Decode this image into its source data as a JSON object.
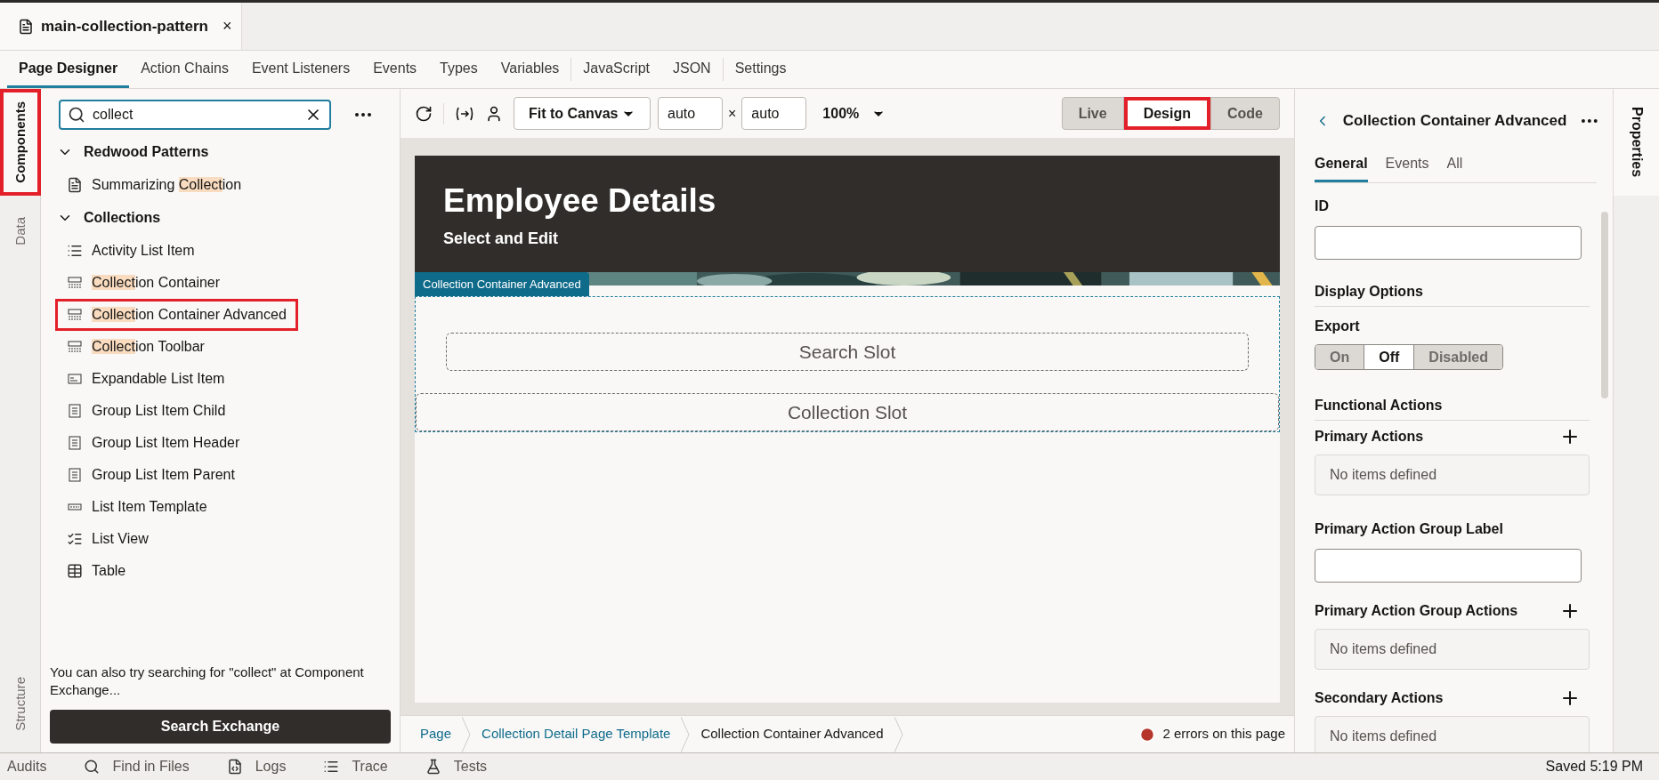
{
  "file_tab": {
    "title": "main-collection-pattern",
    "close": "×"
  },
  "nav_tabs": [
    {
      "label": "Page Designer",
      "selected": true
    },
    {
      "label": "Action Chains",
      "selected": false
    },
    {
      "label": "Event Listeners",
      "selected": false
    },
    {
      "label": "Events",
      "selected": false
    },
    {
      "label": "Types",
      "selected": false
    },
    {
      "label": "Variables",
      "selected": false
    },
    {
      "label": "JavaScript",
      "selected": false
    },
    {
      "label": "JSON",
      "selected": false
    },
    {
      "label": "Settings",
      "selected": false
    }
  ],
  "left_rail": [
    {
      "label": "Components",
      "selected": true,
      "annotated": true
    },
    {
      "label": "Data",
      "selected": false,
      "annotated": false
    },
    {
      "label": "Structure",
      "selected": false,
      "annotated": false
    }
  ],
  "components": {
    "search": {
      "value": "collect"
    },
    "groups": [
      {
        "title": "Redwood Patterns",
        "expanded": true,
        "items": [
          {
            "kind": "summary",
            "annotated": false,
            "segments": [
              {
                "text": "Summarizing ",
                "highlight": false
              },
              {
                "text": "Collect",
                "highlight": true
              },
              {
                "text": "ion",
                "highlight": false
              }
            ]
          }
        ]
      },
      {
        "title": "Collections",
        "expanded": true,
        "items": [
          {
            "kind": "activity",
            "annotated": false,
            "segments": [
              {
                "text": "Activity List Item",
                "highlight": false
              }
            ]
          },
          {
            "kind": "container",
            "annotated": false,
            "segments": [
              {
                "text": "Collect",
                "highlight": true
              },
              {
                "text": "ion Container",
                "highlight": false
              }
            ]
          },
          {
            "kind": "container",
            "annotated": true,
            "segments": [
              {
                "text": "Collect",
                "highlight": true
              },
              {
                "text": "ion Container Advanced",
                "highlight": false
              }
            ]
          },
          {
            "kind": "container",
            "annotated": false,
            "segments": [
              {
                "text": "Collect",
                "highlight": true
              },
              {
                "text": "ion Toolbar",
                "highlight": false
              }
            ]
          },
          {
            "kind": "expandable",
            "annotated": false,
            "segments": [
              {
                "text": "Expandable List Item",
                "highlight": false
              }
            ]
          },
          {
            "kind": "group",
            "annotated": false,
            "segments": [
              {
                "text": "Group List Item Child",
                "highlight": false
              }
            ]
          },
          {
            "kind": "group",
            "annotated": false,
            "segments": [
              {
                "text": "Group List Item Header",
                "highlight": false
              }
            ]
          },
          {
            "kind": "group",
            "annotated": false,
            "segments": [
              {
                "text": "Group List Item Parent",
                "highlight": false
              }
            ]
          },
          {
            "kind": "template",
            "annotated": false,
            "segments": [
              {
                "text": "List Item Template",
                "highlight": false
              }
            ]
          },
          {
            "kind": "listview",
            "annotated": false,
            "segments": [
              {
                "text": "List View",
                "highlight": false
              }
            ]
          },
          {
            "kind": "table",
            "annotated": false,
            "segments": [
              {
                "text": "Table",
                "highlight": false
              }
            ]
          }
        ]
      }
    ],
    "hint": "You can also try searching for \"collect\" at Component Exchange...",
    "exchange_button": "Search Exchange"
  },
  "toolbar": {
    "fit": "Fit to Canvas",
    "width": "auto",
    "times": "×",
    "height": "auto",
    "zoom": "100%",
    "views": [
      {
        "label": "Live",
        "selected": false,
        "annotated": false
      },
      {
        "label": "Design",
        "selected": true,
        "annotated": true
      },
      {
        "label": "Code",
        "selected": false,
        "annotated": false
      }
    ]
  },
  "canvas": {
    "title": "Employee Details",
    "subtitle": "Select and Edit",
    "component_tag": "Collection Container Advanced",
    "slots": [
      "Search Slot",
      "Collection Slot"
    ]
  },
  "breadcrumbs": [
    {
      "label": "Page",
      "current": false
    },
    {
      "label": "Collection Detail Page Template",
      "current": false
    },
    {
      "label": "Collection Container Advanced",
      "current": true
    }
  ],
  "errors": "2 errors on this page",
  "properties": {
    "title": "Collection Container Advanced",
    "rail_label": "Properties",
    "tabs": [
      {
        "label": "General",
        "selected": true
      },
      {
        "label": "Events",
        "selected": false
      },
      {
        "label": "All",
        "selected": false
      }
    ],
    "id_label": "ID",
    "display_options": "Display Options",
    "export_label": "Export",
    "export_options": [
      {
        "label": "On",
        "selected": false
      },
      {
        "label": "Off",
        "selected": true
      },
      {
        "label": "Disabled",
        "selected": false
      }
    ],
    "functional_actions": "Functional Actions",
    "sections": [
      {
        "kind": "list",
        "label": "Primary Actions",
        "empty": "No items defined"
      },
      {
        "kind": "field",
        "label": "Primary Action Group Label"
      },
      {
        "kind": "list",
        "label": "Primary Action Group Actions",
        "empty": "No items defined"
      },
      {
        "kind": "list",
        "label": "Secondary Actions",
        "empty": "No items defined"
      }
    ]
  },
  "status_bar": {
    "items": [
      {
        "label": "Audits",
        "kind": "none"
      },
      {
        "label": "Find in Files",
        "kind": "search"
      },
      {
        "label": "Logs",
        "kind": "logs"
      },
      {
        "label": "Trace",
        "kind": "trace"
      },
      {
        "label": "Tests",
        "kind": "tests"
      }
    ],
    "saved": "Saved 5:19 PM"
  }
}
